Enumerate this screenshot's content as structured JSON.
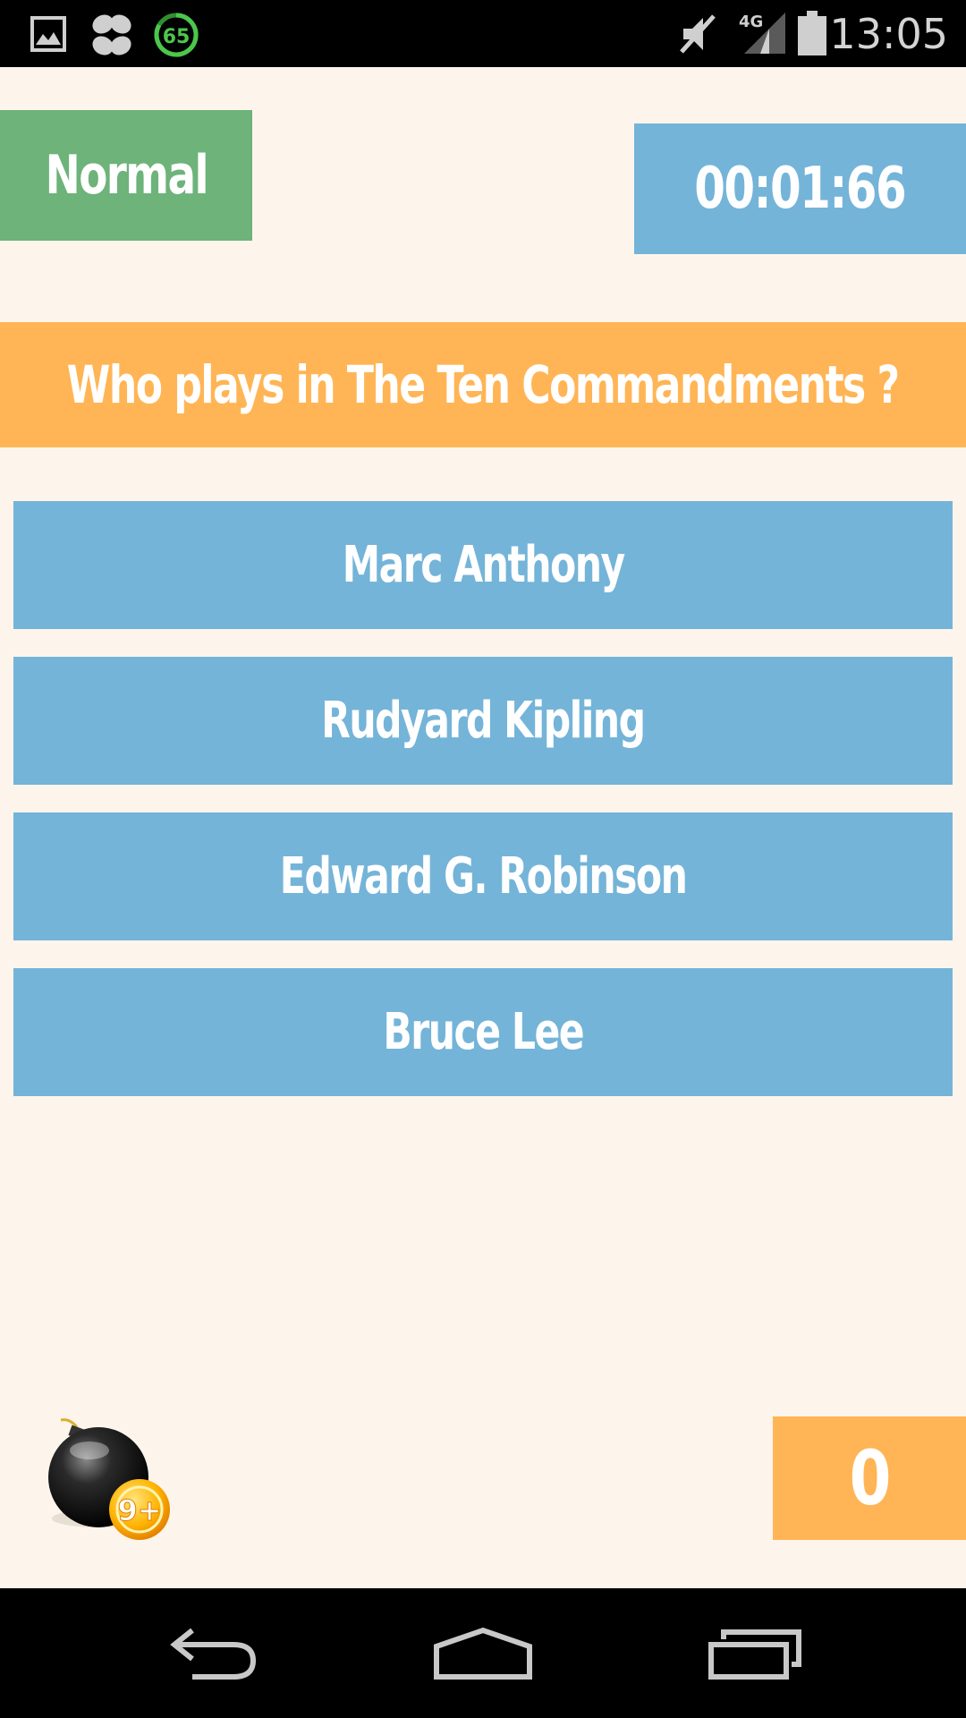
{
  "status_bar": {
    "time": "13:05",
    "battery_saver_level": "65",
    "network_label": "4G",
    "icons": [
      "gallery-icon",
      "fan-icon",
      "battery-saver-icon",
      "mute-icon",
      "signal-icon",
      "battery-icon"
    ]
  },
  "game": {
    "mode": "Normal",
    "timer": "00:01:66",
    "question": "Who plays in The Ten Commandments ?",
    "answers": [
      "Marc Anthony",
      "Rudyard Kipling",
      "Edward G. Robinson",
      "Bruce Lee"
    ],
    "bomb_badge": "9+",
    "score": "0"
  },
  "colors": {
    "background": "#fdf5ec",
    "mode_green": "#6db37a",
    "blue": "#74b4d8",
    "orange": "#ffb555"
  },
  "nav_bar": {
    "icons": [
      "back-icon",
      "home-icon",
      "recents-icon"
    ]
  }
}
